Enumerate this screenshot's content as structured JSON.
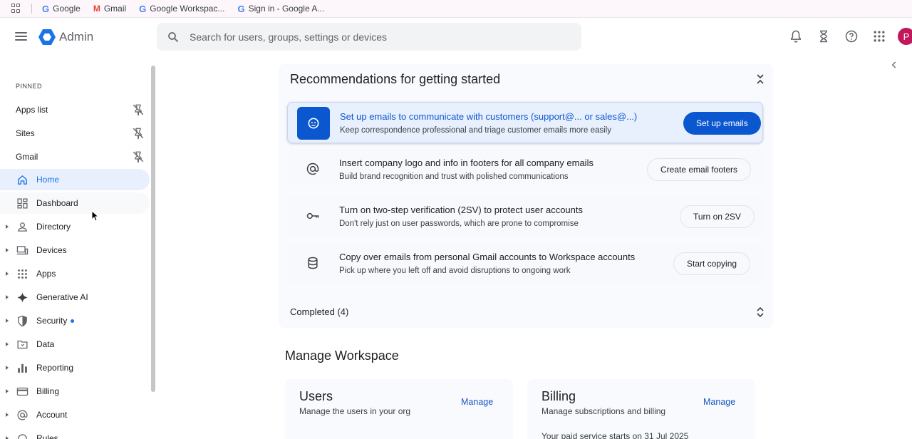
{
  "bookmarks": [
    {
      "icon": "google-g-icon",
      "label": "Google"
    },
    {
      "icon": "gmail-icon",
      "label": "Gmail"
    },
    {
      "icon": "google-g-icon",
      "label": "Google Workspac..."
    },
    {
      "icon": "google-g-icon",
      "label": "Sign in - Google A..."
    }
  ],
  "header": {
    "app_title": "Admin",
    "search_placeholder": "Search for users, groups, settings or devices",
    "avatar_initial": "P",
    "icons": [
      "bell-icon",
      "hourglass-icon",
      "help-icon",
      "apps-grid-icon"
    ]
  },
  "sidebar": {
    "pinned_label": "PINNED",
    "pinned": [
      {
        "label": "Apps list",
        "icon": "unpin-icon"
      },
      {
        "label": "Sites",
        "icon": "unpin-icon"
      },
      {
        "label": "Gmail",
        "icon": "unpin-icon"
      }
    ],
    "nav": [
      {
        "label": "Home",
        "icon": "home-icon",
        "expandable": false,
        "active": true
      },
      {
        "label": "Dashboard",
        "icon": "dashboard-icon",
        "expandable": false
      },
      {
        "label": "Directory",
        "icon": "person-icon",
        "expandable": true
      },
      {
        "label": "Devices",
        "icon": "devices-icon",
        "expandable": true
      },
      {
        "label": "Apps",
        "icon": "apps-grid-icon",
        "expandable": true
      },
      {
        "label": "Generative AI",
        "icon": "sparkle-icon",
        "expandable": true
      },
      {
        "label": "Security",
        "icon": "shield-icon",
        "expandable": true,
        "badge_dot": true
      },
      {
        "label": "Data",
        "icon": "folder-icon",
        "expandable": true
      },
      {
        "label": "Reporting",
        "icon": "bar-chart-icon",
        "expandable": true
      },
      {
        "label": "Billing",
        "icon": "credit-card-icon",
        "expandable": true
      },
      {
        "label": "Account",
        "icon": "at-sign-icon",
        "expandable": true
      },
      {
        "label": "Rules",
        "icon": "rules-icon",
        "expandable": true
      }
    ]
  },
  "recommendations": {
    "title": "Recommendations for getting started",
    "items": [
      {
        "icon": "support-agent-icon",
        "title": "Set up emails to communicate with customers (support@... or sales@...)",
        "subtitle": "Keep correspondence professional and triage customer emails more easily",
        "button": "Set up emails"
      },
      {
        "icon": "at-sign-icon",
        "title": "Insert company logo and info in footers for all company emails",
        "subtitle": "Build brand recognition and trust with polished communications",
        "button": "Create email footers"
      },
      {
        "icon": "key-icon",
        "title": "Turn on two-step verification (2SV) to protect user accounts",
        "subtitle": "Don't rely just on user passwords, which are prone to compromise",
        "button": "Turn on 2SV"
      },
      {
        "icon": "database-icon",
        "title": "Copy over emails from personal Gmail accounts to Workspace accounts",
        "subtitle": "Pick up where you left off and avoid disruptions to ongoing work",
        "button": "Start copying"
      }
    ],
    "completed_label": "Completed (4)"
  },
  "manage": {
    "title": "Manage Workspace",
    "cards": [
      {
        "title": "Users",
        "subtitle": "Manage the users in your org",
        "link": "Manage",
        "extra": ""
      },
      {
        "title": "Billing",
        "subtitle": "Manage subscriptions and billing",
        "link": "Manage",
        "extra": "Your paid service starts on 31 Jul 2025"
      }
    ]
  },
  "colors": {
    "accent": "#0b57d0",
    "link": "#1a57c5",
    "avatar": "#c2185b"
  }
}
